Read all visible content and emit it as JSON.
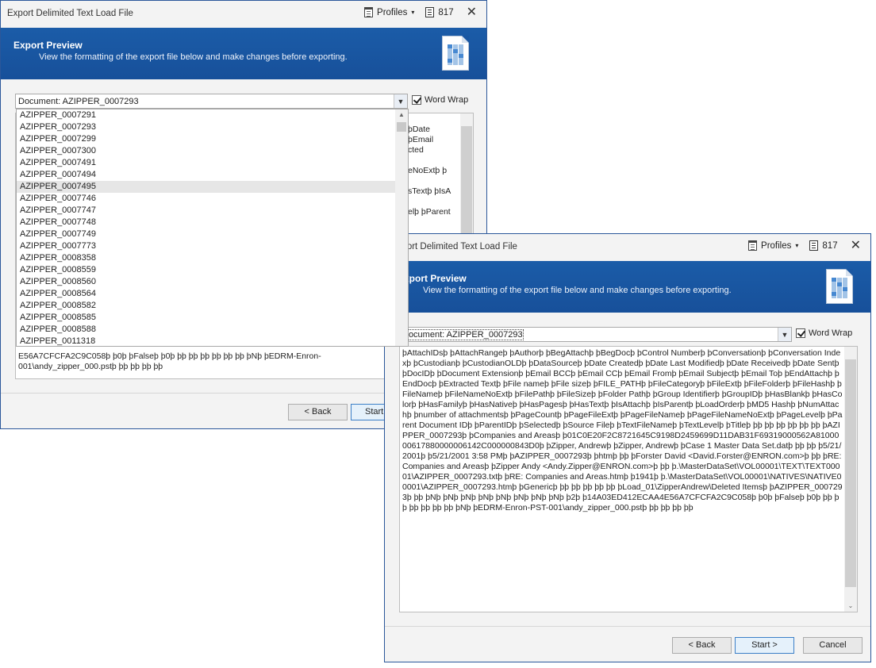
{
  "dialog": {
    "title": "Export Delimited Text Load File",
    "profiles_label": "Profiles",
    "doc_count": "817",
    "close_symbol": "✕",
    "header_title": "Export Preview",
    "header_subtitle": "View the formatting of the export file below and make changes before exporting.",
    "document_select_value": "Document: AZIPPER_0007293",
    "word_wrap_label": "Word Wrap",
    "word_wrap_checked": true,
    "back_label": "< Back",
    "start_label": "Start >",
    "start_label_partial": "Start",
    "cancel_label": "Cancel"
  },
  "dropdown": {
    "selected": "AZIPPER_0007495",
    "items": [
      "AZIPPER_0007291",
      "AZIPPER_0007293",
      "AZIPPER_0007299",
      "AZIPPER_0007300",
      "AZIPPER_0007491",
      "AZIPPER_0007494",
      "AZIPPER_0007495",
      "AZIPPER_0007746",
      "AZIPPER_0007747",
      "AZIPPER_0007748",
      "AZIPPER_0007749",
      "AZIPPER_0007773",
      "AZIPPER_0008358",
      "AZIPPER_0008559",
      "AZIPPER_0008560",
      "AZIPPER_0008564",
      "AZIPPER_0008582",
      "AZIPPER_0008585",
      "AZIPPER_0008588",
      "AZIPPER_0011318"
    ]
  },
  "window1_fragments": {
    "right_lines": [
      "þDate",
      "þEmail",
      "cted",
      "eNoExtþ þ",
      "sTextþ þIsA",
      "elþ þParent"
    ],
    "bottom_lines": [
      "E56A7CFCFA2C9C058þ þ0þ þFalseþ þ0þ þþ þþ þþ þþ þþ þþ þNþ þEDRM-Enron-",
      "001\\andy_zipper_000.pstþ þþ þþ þþ þþ"
    ]
  },
  "preview_text": "þAttachIDsþ þAttachRangeþ þAuthorþ þBegAttachþ þBegDocþ þControl Numberþ þConversationþ þConversation Indexþ þCustodianþ þCustodianOLDþ þDataSourceþ þDate Createdþ þDate Last Modifiedþ þDate Receivedþ þDate Sentþ þDocIDþ þDocument Extensionþ þEmail BCCþ þEmail CCþ þEmail Fromþ þEmail Subjectþ þEmail Toþ þEndAttachþ þEndDocþ þExtracted Textþ þFile nameþ þFile sizeþ þFILE_PATHþ þFileCategoryþ þFileExtþ þFileFolderþ þFileHashþ þFileNameþ þFileNameNoExtþ þFilePathþ þFileSizeþ þFolder Pathþ þGroup Identifierþ þGroupIDþ þHasBlankþ þHasColorþ þHasFamilyþ þHasNativeþ þHasPagesþ þHasTextþ þIsAttachþ þIsParentþ þLoadOrderþ þMD5 Hashþ þNumAttachþ þnumber of attachmentsþ þPageCountþ þPageFileExtþ þPageFileNameþ þPageFileNameNoExtþ þPageLevelþ þParent Document IDþ þParentIDþ þSelectedþ þSource Fileþ þTextFileNameþ þTextLevelþ þTitleþ þþ þþ þþ þþ þþ þþ þAZIPPER_0007293þ þCompanies and Areasþ þ01C0E20F2C8721645C9198D2459699D11DAB31F69319000562A8100000617880000006142C000000843D0þ þZipper, Andrewþ þZipper, Andrewþ þCase 1 Master Data Set.datþ þþ þþ þ5/21/2001þ þ5/21/2001 3:58 PMþ þAZIPPER_0007293þ þhtmþ þþ þForster David <David.Forster@ENRON.com>þ þþ þRE: Companies and Areasþ þZipper  Andy <Andy.Zipper@ENRON.com>þ þþ þ.\\MasterDataSet\\VOL00001\\TEXT\\TEXT00001\\AZIPPER_0007293.txtþ þRE: Companies and Areas.htmþ þ1941þ þ.\\MasterDataSet\\VOL00001\\NATIVES\\NATIVE00001\\AZIPPER_0007293.htmþ þGenericþ þþ þþ þþ þþ þþ þLoad_01\\ZipperAndrew\\Deleted Itemsþ þAZIPPER_0007293þ þþ þNþ þNþ þNþ þNþ þNþ þNþ þNþ þNþ þ2þ þ14A03ED412ECAA4E56A7CFCFA2C9C058þ þ0þ þFalseþ þ0þ þþ þþ þþ þþ þþ þþ þNþ þEDRM-Enron-PST-001\\andy_zipper_000.pstþ þþ þþ þþ þþ",
  "colors": {
    "header_blue": "#1b5ca8",
    "window_border": "#2b579a",
    "selection": "#e6e6e6"
  }
}
